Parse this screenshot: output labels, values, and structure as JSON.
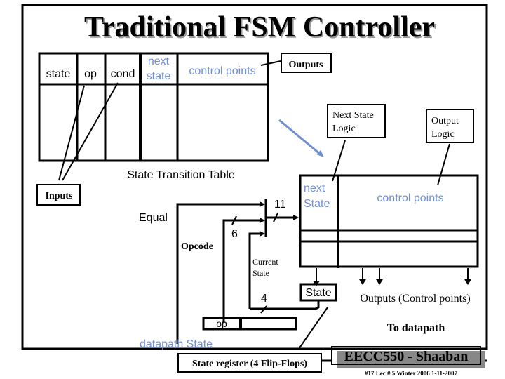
{
  "title": "Traditional FSM Controller",
  "table": {
    "headers": [
      "state",
      "op",
      "cond",
      "next",
      "state",
      "control points"
    ],
    "caption": "State Transition Table"
  },
  "labels": {
    "outputs": "Outputs",
    "inputs": "Inputs",
    "next_state_logic_1": "Next State",
    "next_state_logic_2": "Logic",
    "output_logic_1": "Output",
    "output_logic_2": "Logic",
    "equal": "Equal",
    "opcode": "Opcode",
    "current_state_1": "Current",
    "current_state_2": "State",
    "bits_11": "11",
    "bits_6": "6",
    "bits_4": "4",
    "rom_next_1": "next",
    "rom_next_2": "State",
    "rom_control_points": "control points",
    "state_box": "State",
    "outputs_control_points": "Outputs (Control points)",
    "to_datapath": "To datapath",
    "op_field": "op",
    "datapath_state": "datapath State",
    "state_register": "State register (4 Flip-Flops)"
  },
  "footer": {
    "course": "EECC550 - Shaaban",
    "slide_info": "#17   Lec # 5  Winter 2006  1-11-2007"
  },
  "colors": {
    "accent_blue": "#6f8fd0",
    "line": "#000000",
    "shadow": "#888888"
  }
}
